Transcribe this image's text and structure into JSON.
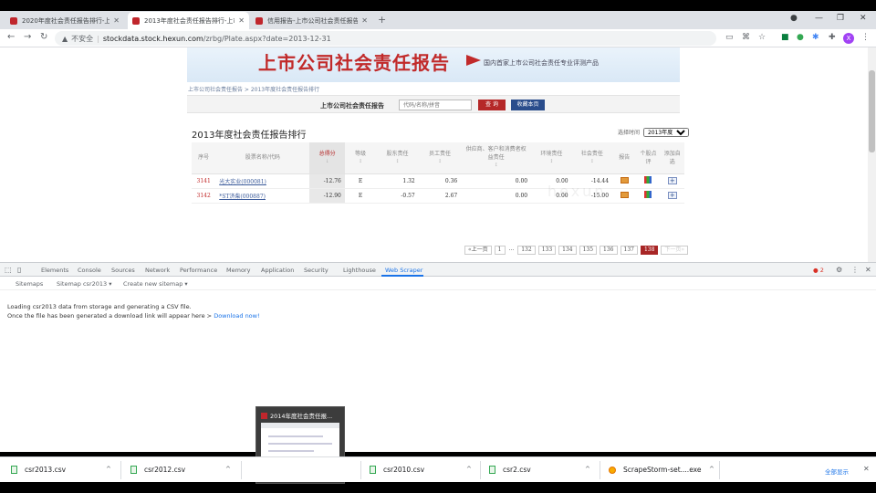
{
  "tabs": [
    {
      "title": "2020年度社会责任报告排行-上市...",
      "active": false
    },
    {
      "title": "2013年度社会责任报告排行-上市...",
      "active": true
    },
    {
      "title": "信用报告-上市公司社会责任报告...",
      "active": false
    }
  ],
  "address": {
    "warning": "不安全",
    "host": "stockdata.stock.hexun.com",
    "path": "/zrbg/Plate.aspx?date=2013-12-31"
  },
  "profile_initial": "X",
  "page": {
    "banner_title": "上市公司社会责任报告",
    "banner_sub": "国内首家上市公司社会责任专业评测产品",
    "breadcrumb": "上市公司社会责任报告 > 2013年度社会责任报告排行",
    "search_label": "上市公司社会责任报告",
    "search_placeholder": "代码/名称/拼音",
    "search_button": "查 询",
    "bookmark_button": "收藏本页",
    "ranking_title": "2013年度社会责任报告排行",
    "time_label": "选择时间",
    "time_value": "2013年度",
    "columns": [
      {
        "label": "序号",
        "sub": ""
      },
      {
        "label": "股票名称/代码",
        "sub": ""
      },
      {
        "label": "总得分",
        "sub": "↓"
      },
      {
        "label": "等级",
        "sub": "↕"
      },
      {
        "label": "股东责任",
        "sub": "↕"
      },
      {
        "label": "员工责任",
        "sub": "↕"
      },
      {
        "label": "供应商、客户和消费者权益责任",
        "sub": "↕"
      },
      {
        "label": "环境责任",
        "sub": "↕"
      },
      {
        "label": "社会责任",
        "sub": "↕"
      },
      {
        "label": "报告",
        "sub": ""
      },
      {
        "label": "个股点评",
        "sub": ""
      },
      {
        "label": "添加自选",
        "sub": ""
      }
    ],
    "rows": [
      {
        "rank": "3141",
        "name": "光大实业(000081)",
        "score": "-12.76",
        "grade": "E",
        "shareholder": "1.32",
        "employee": "0.36",
        "supplier": "0.00",
        "environment": "0.00",
        "social": "-14.44"
      },
      {
        "rank": "3142",
        "name": "*ST济柴(000887)",
        "score": "-12.90",
        "grade": "E",
        "shareholder": "-0.57",
        "employee": "2.67",
        "supplier": "0.00",
        "environment": "0.00",
        "social": "-15.00"
      }
    ],
    "watermark": "hexun",
    "pager": {
      "prev": "«上一页",
      "first": "1",
      "ellipsis": "...",
      "pages": [
        "132",
        "133",
        "134",
        "135",
        "136",
        "137"
      ],
      "current": "138",
      "next": "下一页»"
    }
  },
  "devtools": {
    "tabs": [
      "Elements",
      "Console",
      "Sources",
      "Network",
      "Performance",
      "Memory",
      "Application",
      "Security",
      "Lighthouse",
      "Web Scraper"
    ],
    "active_tab": "Web Scraper",
    "error_count": "2",
    "sub": [
      "Sitemaps",
      "Sitemap csr2013 ▾",
      "Create new sitemap ▾"
    ],
    "message_line1": "Loading csr2013 data from storage and generating a CSV file.",
    "message_line2": "Once the file has been generated a download link will appear here >",
    "download_link": "Download now!"
  },
  "preview": {
    "title": "2014年度社会责任报..."
  },
  "downloads": {
    "items": [
      "csr2013.csv",
      "csr2012.csv",
      "csr2010.csv",
      "csr2.csv",
      "ScrapeStorm-set....exe"
    ],
    "show_all": "全部显示"
  }
}
